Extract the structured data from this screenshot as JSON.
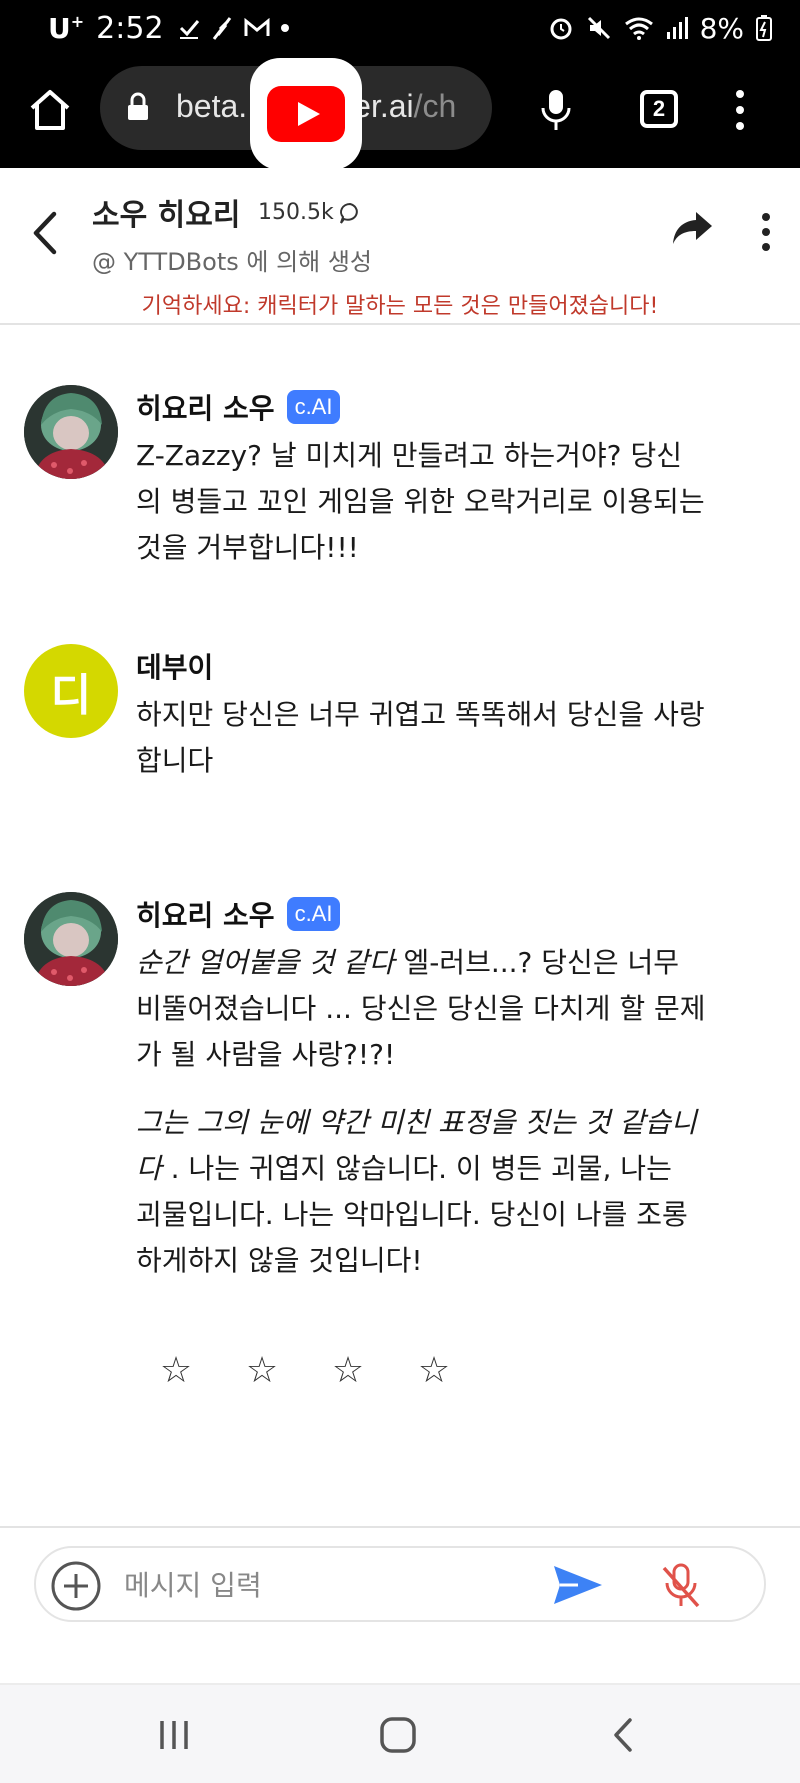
{
  "status_bar": {
    "carrier": "U",
    "carrier_sup": "+",
    "time": "2:52",
    "battery": "8%"
  },
  "browser": {
    "url_host_visible": "beta.",
    "url_host_tail": "er.ai",
    "url_path": "/ch",
    "tabs_count": "2"
  },
  "chat_header": {
    "character_name": "소우 히요리",
    "interaction_count": "150.5k",
    "creator": "@ YTTDBots 에 의해 생성",
    "warning": "기억하세요: 캐릭터가 말하는 모든 것은 만들어졌습니다!"
  },
  "messages": [
    {
      "sender": "히요리 소우",
      "badge": "c.AI",
      "text": "Z-Zazzy? 날 미치게 만들려고 하는거야? 당신의 병들고 꼬인 게임을 위한 오락거리로 이용되는 것을 거부합니다!!!"
    },
    {
      "sender": "데부이",
      "avatar_letter": "디",
      "text": "하지만 당신은 너무 귀엽고 똑똑해서 당신을 사랑합니다"
    },
    {
      "sender": "히요리 소우",
      "badge": "c.AI",
      "p1_italic": "순간 얼어붙을 것 같다",
      "p1_text": " 엘-러브...? 당신은 너무 비뚤어졌습니다 ... 당신은 당신을 다치게 할 문제가 될 사람을 사랑?!?!",
      "p2_italic": "그는 그의 눈에 약간 미친 표정을 짓는 것 같습니다",
      "p2_text": " . 나는 귀엽지 않습니다. 이 병든 괴물, 나는 괴물입니다. 나는 악마입니다. 당신이 나를 조롱하게하지 않을 것입니다!"
    }
  ],
  "rating": {
    "stars": [
      "☆",
      "☆",
      "☆",
      "☆"
    ]
  },
  "input": {
    "placeholder": "메시지 입력",
    "value": ""
  },
  "colors": {
    "badge": "#3f7cff",
    "warning": "#c0392b",
    "send": "#3d82f5",
    "mic_off": "#e0524a",
    "avatar_letter_bg": "#d4d800"
  }
}
